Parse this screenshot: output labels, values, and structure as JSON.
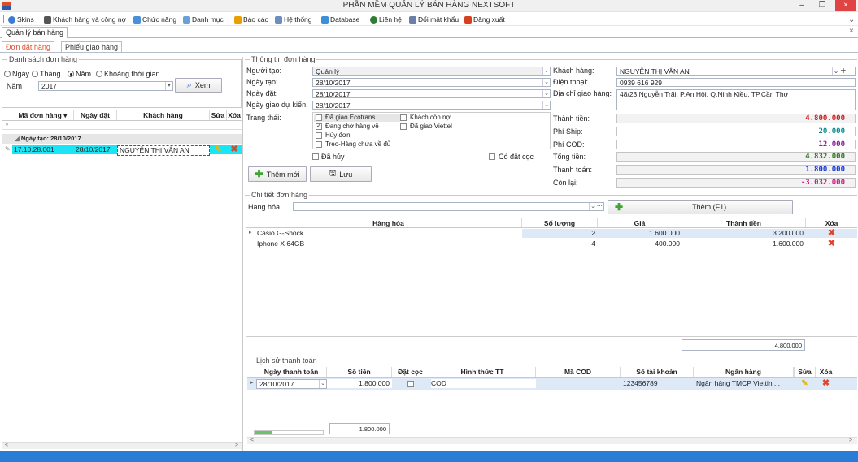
{
  "window": {
    "title": "PHẦN MỀM QUẢN LÝ BÁN HÀNG NEXTSOFT",
    "min": "–",
    "restore": "❐",
    "close": "×"
  },
  "menu": [
    {
      "label": "Skins",
      "color": "#3a7bd5"
    },
    {
      "label": "Khách hàng và công nợ",
      "color": "#555555"
    },
    {
      "label": "Chức năng",
      "color": "#4a90d9"
    },
    {
      "label": "Danh mục",
      "color": "#6aa0d8"
    },
    {
      "label": "Báo cáo",
      "color": "#e8a000"
    },
    {
      "label": "Hệ thống",
      "color": "#6a8fbf"
    },
    {
      "label": "Database",
      "color": "#3f8fd8"
    },
    {
      "label": "Liên hệ",
      "color": "#2e7d32"
    },
    {
      "label": "Đổi mật khẩu",
      "color": "#6a7fa8"
    },
    {
      "label": "Đăng xuất",
      "color": "#d64020"
    }
  ],
  "menu_chevron": "⌄",
  "doc_tab": "Quản lý bán hàng",
  "doc_tab_close": "×",
  "tabs": {
    "order": "Đơn đặt hàng",
    "receipt": "Phiếu giao hàng"
  },
  "order_list": {
    "title": "Danh sách đơn hàng",
    "filters": [
      {
        "label": "Ngày",
        "on": false
      },
      {
        "label": "Tháng",
        "on": false
      },
      {
        "label": "Năm",
        "on": true
      },
      {
        "label": "Khoảng thời gian",
        "on": false
      }
    ],
    "year_label": "Năm",
    "year_value": "2017",
    "view_button": "Xem",
    "columns": [
      "Mã đơn hàng",
      "Ngày đặt",
      "Khách hàng",
      "Sửa",
      "Xóa"
    ],
    "group_label": "Ngày tạo: 28/10/2017",
    "rows": [
      {
        "code": "17.10.28.001",
        "date": "28/10/2017",
        "customer": "NGUYỄN THỊ VÂN AN"
      }
    ]
  },
  "order_info": {
    "title": "Thông tin đơn hàng",
    "creator_label": "Người tạo:",
    "creator": "Quản lý",
    "created_label": "Ngày tạo:",
    "created": "28/10/2017",
    "order_date_label": "Ngày đặt:",
    "order_date": "28/10/2017",
    "expected_label": "Ngày giao dự kiến:",
    "expected": "28/10/2017",
    "status_label": "Trạng thái:",
    "statuses_col1": [
      {
        "label": "Đã giao Ecotrans",
        "checked": false
      },
      {
        "label": "Đang chờ hàng về",
        "checked": true
      },
      {
        "label": "Hủy đơn",
        "checked": false
      },
      {
        "label": "Treo-Hàng chưa về đủ",
        "checked": false
      }
    ],
    "statuses_col2": [
      {
        "label": "Khách còn nợ",
        "checked": false
      },
      {
        "label": "Đã giao Viettel",
        "checked": false
      }
    ],
    "cancelled": "Đã hủy",
    "deposit": "Có đặt cọc",
    "add_button": "Thêm mới",
    "save_button": "Lưu",
    "customer_label": "Khách hàng:",
    "customer": "NGUYỄN THỊ VÂN AN",
    "phone_label": "Điện thoại:",
    "phone": "0939 616 929",
    "address_label": "Địa chỉ giao hàng:",
    "address": "48/23 Nguyễn Trãi, P.An Hội, Q.Ninh Kiều, TP.Cần Thơ",
    "subtotal_label": "Thành tiền:",
    "subtotal": "4.800.000",
    "ship_label": "Phí Ship:",
    "ship": "20.000",
    "cod_label": "Phí COD:",
    "cod": "12.000",
    "total_label": "Tổng tiền:",
    "total": "4.832.000",
    "paid_label": "Thanh toán:",
    "paid": "1.800.000",
    "remaining_label": "Còn lại:",
    "remaining": "-3.032.000"
  },
  "detail": {
    "title": "Chi tiết đơn hàng",
    "goods_label": "Hàng hóa",
    "add_button": "Thêm (F1)",
    "columns": [
      "Hàng hóa",
      "Số lượng",
      "Giá",
      "Thành tiền",
      "Xóa"
    ],
    "rows": [
      {
        "name": "Casio G-Shock",
        "qty": "2",
        "price": "1.600.000",
        "amount": "3.200.000"
      },
      {
        "name": "Iphone X 64GB",
        "qty": "4",
        "price": "400.000",
        "amount": "1.600.000"
      }
    ],
    "sum": "4.800.000"
  },
  "payments": {
    "title": "Lịch sử thanh toán",
    "columns": [
      "Ngày thanh toán",
      "Số tiền",
      "Đặt cọc",
      "Hình thức TT",
      "Mã COD",
      "Số tài khoản",
      "Ngân hàng",
      "Sửa",
      "Xóa"
    ],
    "rows": [
      {
        "date": "28/10/2017",
        "amount": "1.800.000",
        "method": "COD",
        "cod": "",
        "account": "123456789",
        "bank": "Ngân hàng TMCP Viettin ..."
      }
    ],
    "sum": "1.800.000"
  }
}
